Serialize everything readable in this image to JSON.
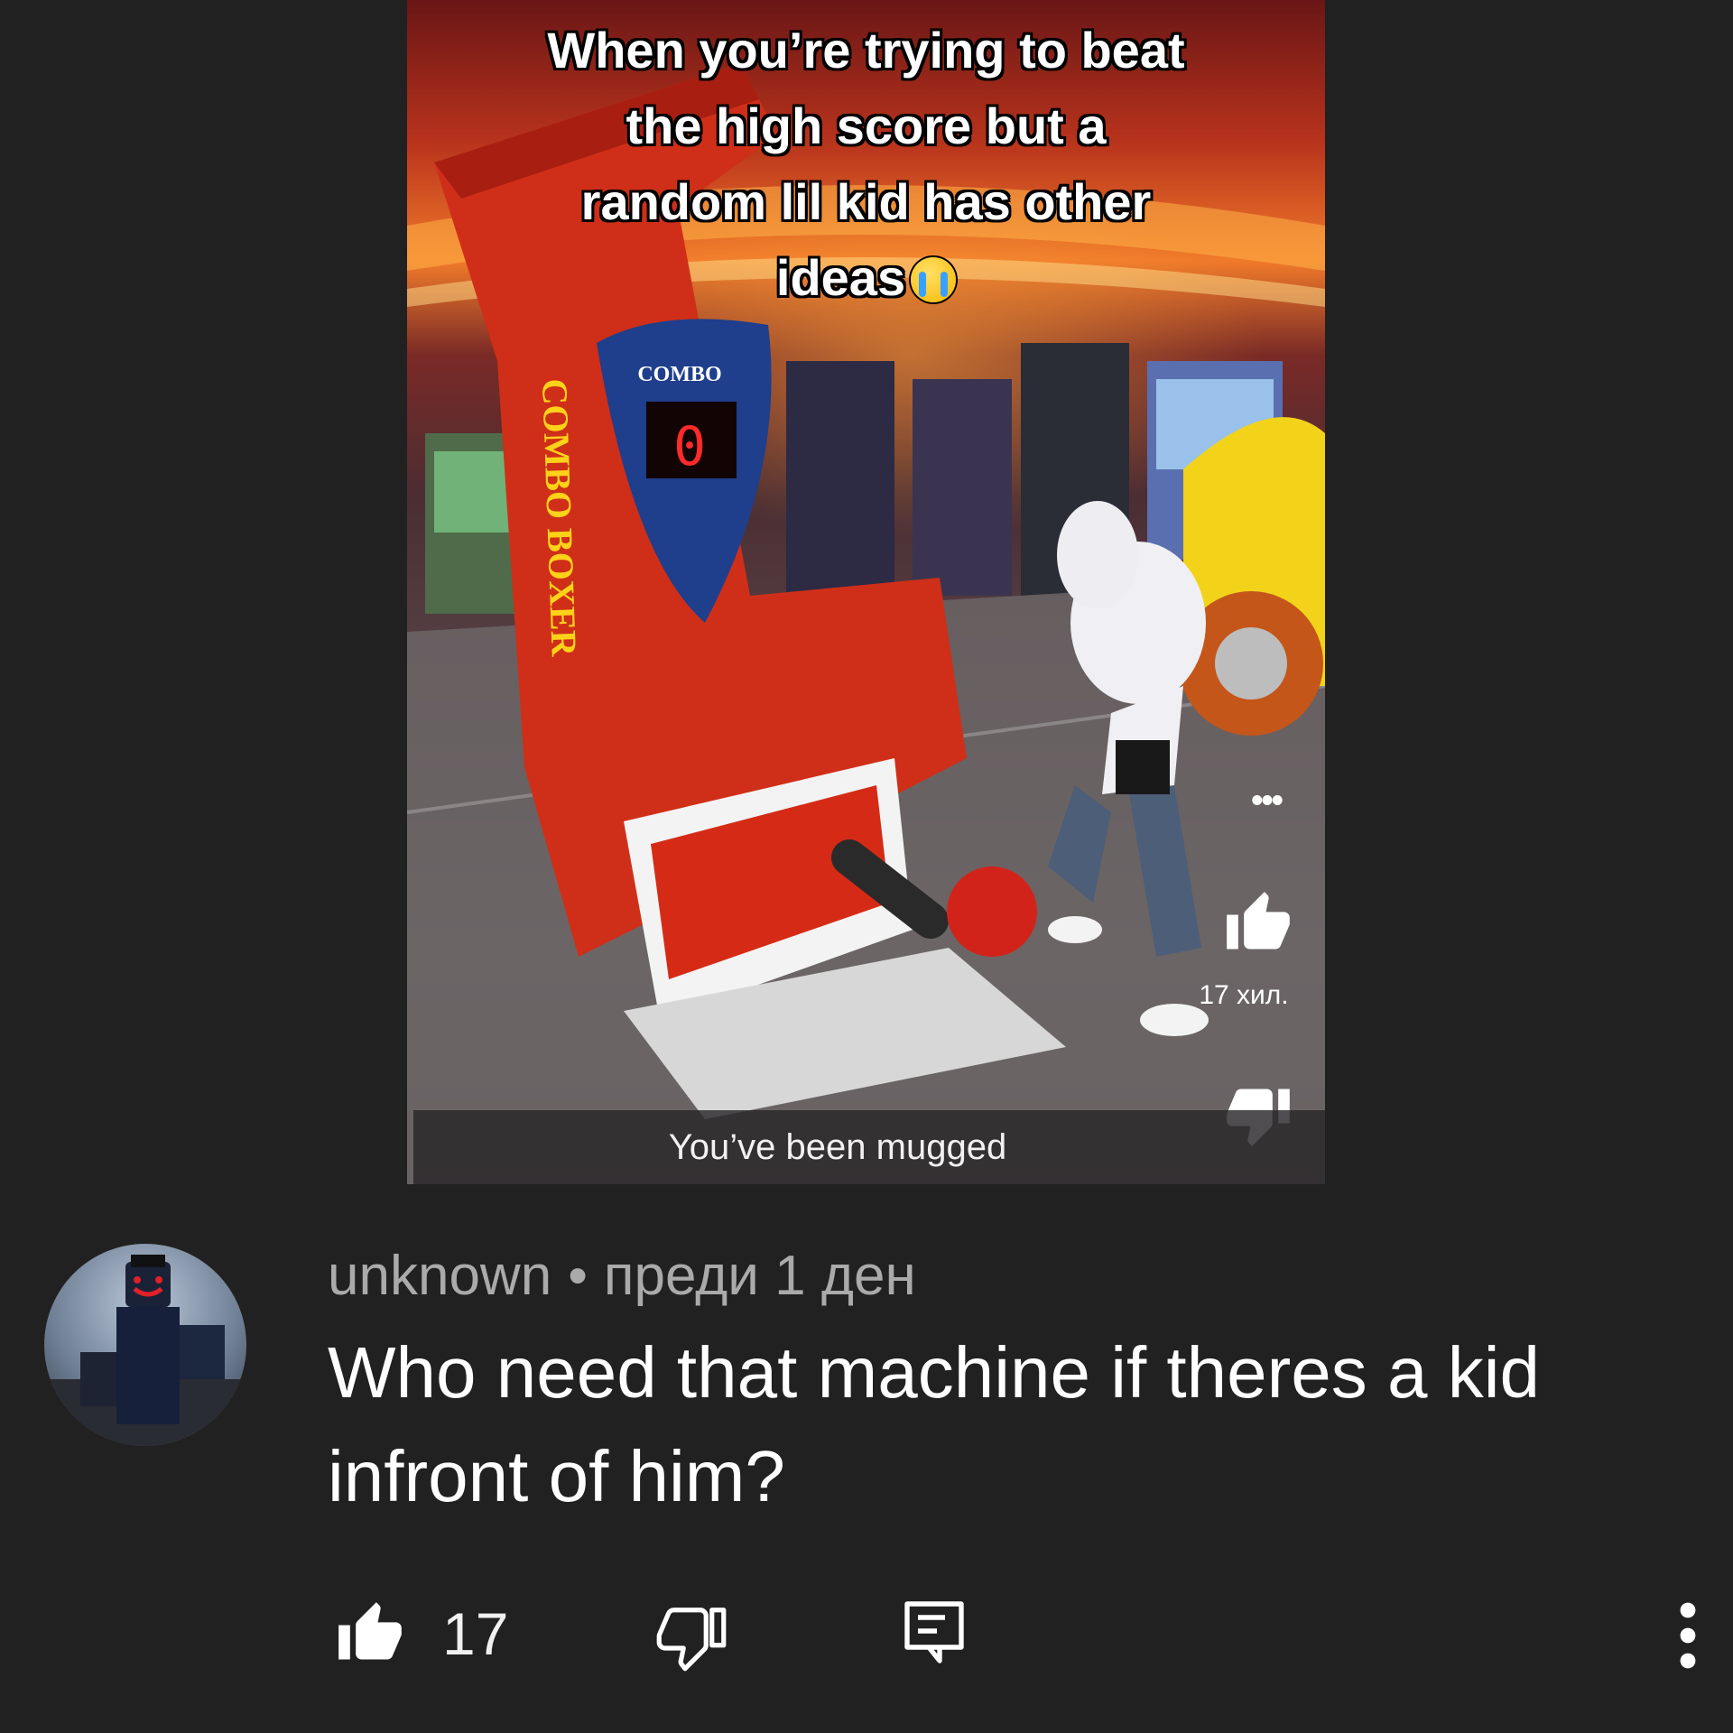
{
  "video": {
    "caption": "When you're trying to beat the high score but a random lil kid has other ideas",
    "caption_lines": [
      "When you’re trying to beat",
      "the high score but a",
      "random lil kid has other",
      "ideas"
    ],
    "subtitle": "You’ve been mugged",
    "like_count": "17 хил.",
    "machine_label": "COMBO",
    "machine_side_label": "COMBO BOXER",
    "score_display": "0"
  },
  "comment": {
    "author": "unknown",
    "separator": "•",
    "time": "преди 1 ден",
    "text_lines": [
      "Who need that machine if theres a kid",
      "infront of him?"
    ],
    "like_count": "17"
  },
  "icons": {
    "more_video": "more-horizontal-icon",
    "like": "thumbs-up-icon",
    "dislike": "thumbs-down-icon",
    "reply": "reply-comment-icon",
    "more": "more-vertical-icon"
  },
  "colors": {
    "background": "#212121",
    "meta_text": "#aaaaaa",
    "text": "#ffffff"
  }
}
